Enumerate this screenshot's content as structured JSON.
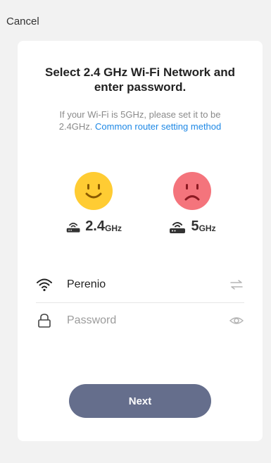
{
  "header": {
    "cancel_label": "Cancel"
  },
  "card": {
    "title_line1": "Select 2.4 GHz Wi-Fi Network and",
    "title_line2": "enter password.",
    "subtitle_line1": "If your Wi-Fi is 5GHz, please set it to be",
    "subtitle_prefix": "2.4GHz.",
    "subtitle_link": "Common router setting method"
  },
  "bands": [
    {
      "number": "2.4",
      "unit": "GHz",
      "face": "smile-face-icon",
      "color": "#ffcc33"
    },
    {
      "number": "5",
      "unit": "GHz",
      "face": "sad-face-icon",
      "color": "#f4747c"
    }
  ],
  "form": {
    "ssid_value": "Perenio",
    "password_placeholder": "Password",
    "next_label": "Next"
  },
  "colors": {
    "link": "#1e88e5",
    "button": "#656e8c",
    "background": "#f2f2f2"
  }
}
